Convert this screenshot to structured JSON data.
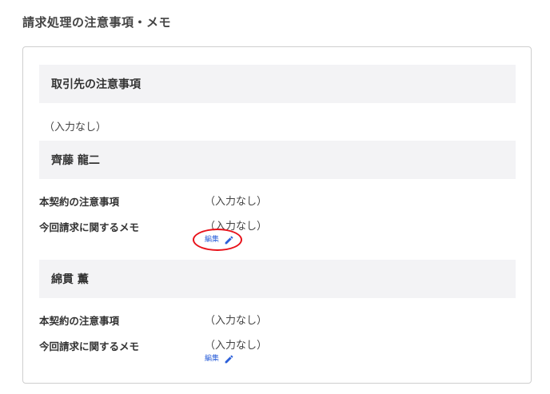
{
  "page": {
    "title": "請求処理の注意事項・メモ"
  },
  "client": {
    "header": "取引先の注意事項",
    "value": "（入力なし）"
  },
  "persons": [
    {
      "name": "齊藤 龍二",
      "contract_note_label": "本契約の注意事項",
      "contract_note_value": "（入力なし）",
      "billing_memo_label": "今回請求に関するメモ",
      "billing_memo_value": "（入力なし）",
      "edit_label": "編集",
      "edit_icon": "pencil-icon"
    },
    {
      "name": "綿貫 薫",
      "contract_note_label": "本契約の注意事項",
      "contract_note_value": "（入力なし）",
      "billing_memo_label": "今回請求に関するメモ",
      "billing_memo_value": "（入力なし）",
      "edit_label": "編集",
      "edit_icon": "pencil-icon"
    }
  ],
  "colors": {
    "link": "#2b5fd9",
    "header_bg": "#f3f3f5",
    "annotation_ring": "#e8121a"
  }
}
